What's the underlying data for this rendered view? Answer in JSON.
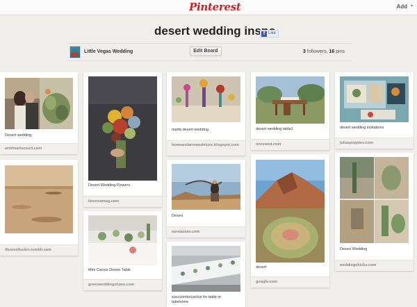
{
  "header": {
    "logo": "Pinterest",
    "add_label": "Add",
    "add_caret": "▾"
  },
  "board": {
    "title": "desert wedding inspo",
    "like_label": "Like",
    "owner_name": "Little Vegas Wedding",
    "edit_label": "Edit Board",
    "followers": "3",
    "followers_label": " followers, ",
    "pins": "16",
    "pins_label": " pins"
  },
  "pins": [
    {
      "description": "Desert wedding.",
      "source": "arinheartscourt.com"
    },
    {
      "description": "",
      "source": "illusionfusion.tumblr.com"
    },
    {
      "description": "Desert Wedding Flowers",
      "source": "iloveswmag.com"
    },
    {
      "description": "Mini Cactus Dinner Table",
      "source": "greenweddingshoes.com"
    },
    {
      "description": "marfa desert wedding",
      "source": "bowsandarrowsdeluxe.blogspot.com"
    },
    {
      "description": "Desert",
      "source": "saralazaro.com"
    },
    {
      "description": "succulents/cactus for table or takehome",
      "source": ""
    },
    {
      "description": "desert wedding table1",
      "source": "oncewed.com"
    },
    {
      "description": "desert",
      "source": "google.com"
    },
    {
      "description": "desert wedding invitations",
      "source": "juliaspoppies.com"
    },
    {
      "description": "Desert Wedding",
      "source": "weddingchicks.com"
    }
  ]
}
